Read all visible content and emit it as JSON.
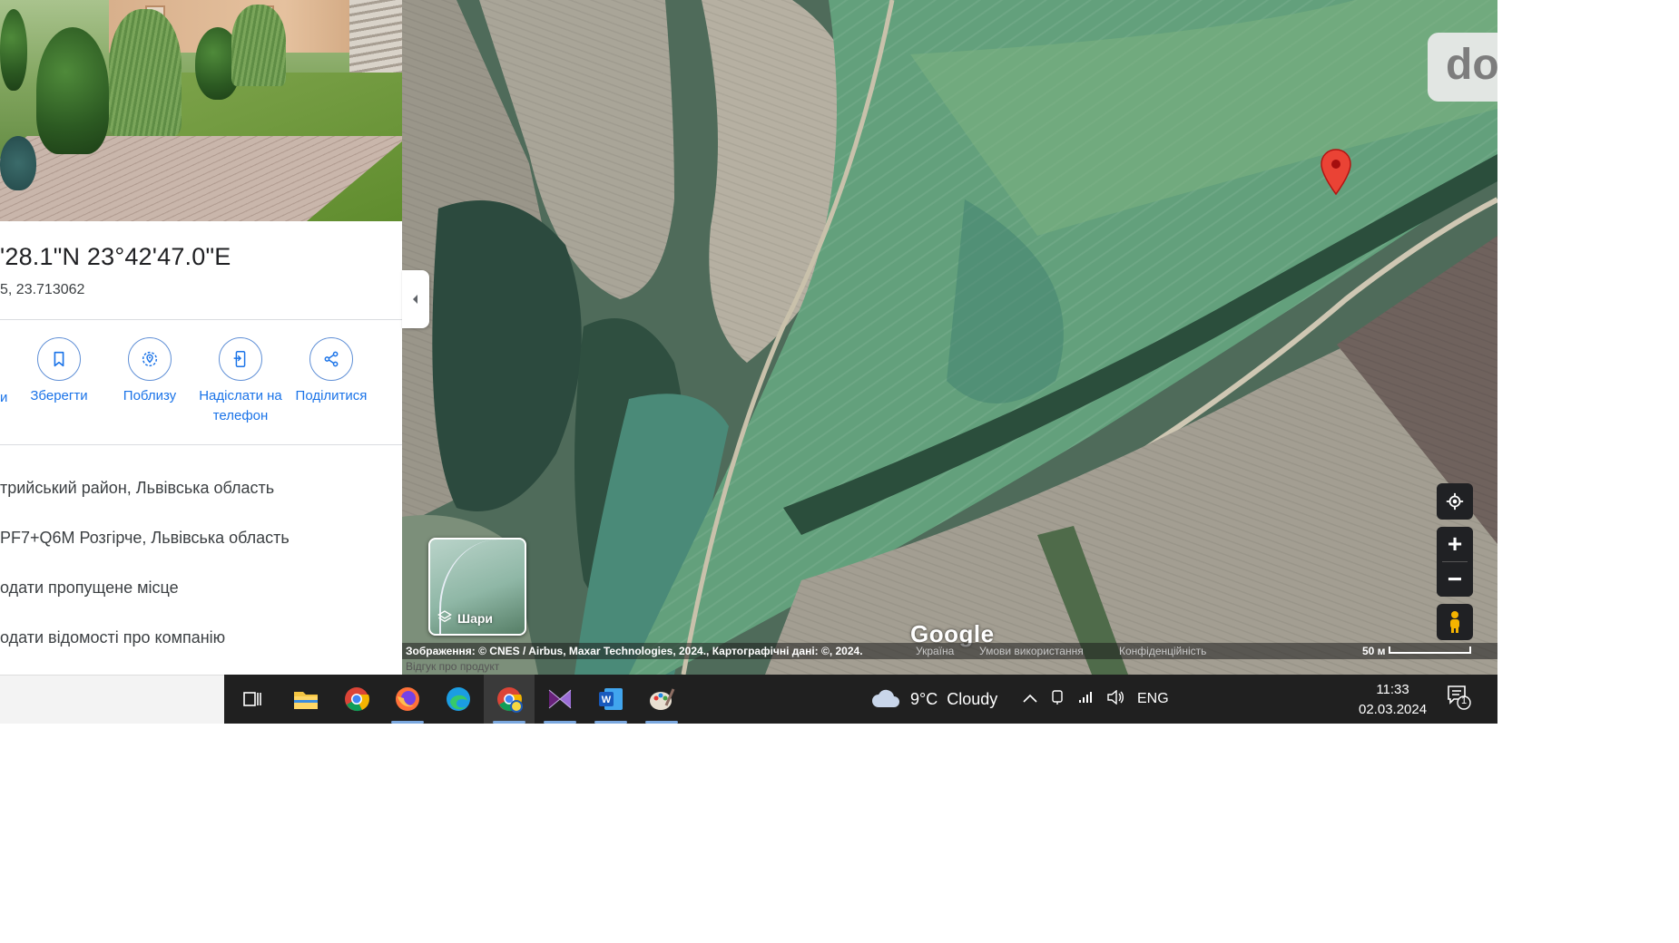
{
  "place": {
    "coords_title": "'28.1\"N 23°42'47.0\"E",
    "coords_decimal": "5, 23.713062"
  },
  "actions": {
    "partial_label": "и",
    "items": [
      {
        "label": "Зберегти",
        "icon": "bookmark-icon"
      },
      {
        "label": "Поблизу",
        "icon": "nearby-icon"
      },
      {
        "label": "Надіслати на телефон",
        "icon": "send-to-phone-icon"
      },
      {
        "label": "Поділитися",
        "icon": "share-icon"
      }
    ]
  },
  "info": {
    "region": "трийський район, Львівська область",
    "plus_code": "PF7+Q6M Розгірче, Львівська область",
    "add_missing": "одати пропущене місце",
    "add_business": "одати відомості про компанію"
  },
  "map": {
    "layers_label": "Шари",
    "google_logo": "Google",
    "badge_text": "do",
    "attribution": "Зображення: © CNES / Airbus, Maxar Technologies, 2024., Картографічні дані: ©, 2024.",
    "country": "Україна",
    "terms": "Умови використання",
    "privacy": "Конфіденційність",
    "scale": "50 м",
    "feedback": "Відгук про продукт",
    "pin_color": "#ea4335"
  },
  "taskbar": {
    "apps": [
      "task-view",
      "file-explorer",
      "chrome",
      "firefox",
      "edge",
      "chrome-profile",
      "visual-studio",
      "word",
      "paint"
    ],
    "weather_temp": "9°C",
    "weather_text": "Cloudy",
    "lang": "ENG",
    "time": "11:33",
    "date": "02.03.2024",
    "notification_count": "1"
  }
}
